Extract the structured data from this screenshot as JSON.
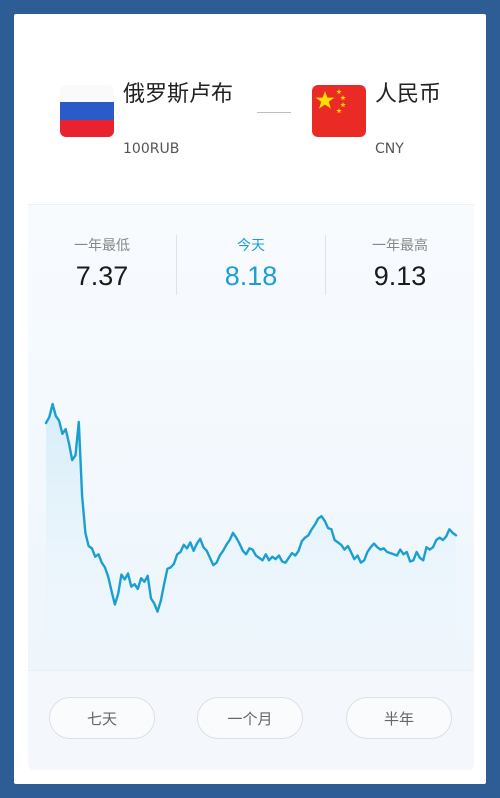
{
  "from_currency": {
    "name": "俄罗斯卢布",
    "code": "100RUB",
    "flag": "russia-flag-icon"
  },
  "to_currency": {
    "name": "人民币",
    "code": "CNY",
    "flag": "china-flag-icon"
  },
  "stats": {
    "low_label": "一年最低",
    "low_value": "7.37",
    "today_label": "今天",
    "today_value": "8.18",
    "high_label": "一年最高",
    "high_value": "9.13"
  },
  "colors": {
    "accent": "#1b9fd1",
    "frame": "#2d5d94",
    "russia_white": "#fafafa",
    "russia_blue": "#2b5bc9",
    "russia_red": "#e8232f",
    "china_red": "#ea2a25",
    "china_star": "#ffde00"
  },
  "range_buttons": [
    "七天",
    "一个月",
    "半年"
  ],
  "chart_data": {
    "type": "line",
    "title": "",
    "xlabel": "",
    "ylabel": "",
    "ylim": [
      7.37,
      9.13
    ],
    "series": [
      {
        "values": [
          8.97,
          9.02,
          9.13,
          9.03,
          8.99,
          8.88,
          8.92,
          8.8,
          8.66,
          8.7,
          8.98,
          8.36,
          8.05,
          7.94,
          7.92,
          7.85,
          7.87,
          7.8,
          7.76,
          7.68,
          7.56,
          7.45,
          7.54,
          7.7,
          7.66,
          7.71,
          7.6,
          7.62,
          7.58,
          7.67,
          7.64,
          7.69,
          7.5,
          7.46,
          7.39,
          7.48,
          7.62,
          7.75,
          7.76,
          7.79,
          7.87,
          7.89,
          7.95,
          7.92,
          7.97,
          7.9,
          7.96,
          8.0,
          7.93,
          7.9,
          7.84,
          7.78,
          7.8,
          7.86,
          7.9,
          7.95,
          7.99,
          8.05,
          8.01,
          7.96,
          7.9,
          7.87,
          7.92,
          7.91,
          7.86,
          7.84,
          7.82,
          7.87,
          7.82,
          7.85,
          7.83,
          7.86,
          7.81,
          7.8,
          7.84,
          7.88,
          7.86,
          7.9,
          7.98,
          8.01,
          8.03,
          8.08,
          8.12,
          8.17,
          8.19,
          8.15,
          8.09,
          8.08,
          7.99,
          7.97,
          7.95,
          7.91,
          7.94,
          7.89,
          7.83,
          7.86,
          7.8,
          7.82,
          7.89,
          7.93,
          7.96,
          7.93,
          7.91,
          7.92,
          7.89,
          7.88,
          7.87,
          7.86,
          7.91,
          7.87,
          7.89,
          7.81,
          7.82,
          7.89,
          7.84,
          7.82,
          7.93,
          7.91,
          7.93,
          7.99,
          8.01,
          7.99,
          8.02,
          8.08,
          8.05,
          8.03
        ]
      }
    ]
  }
}
